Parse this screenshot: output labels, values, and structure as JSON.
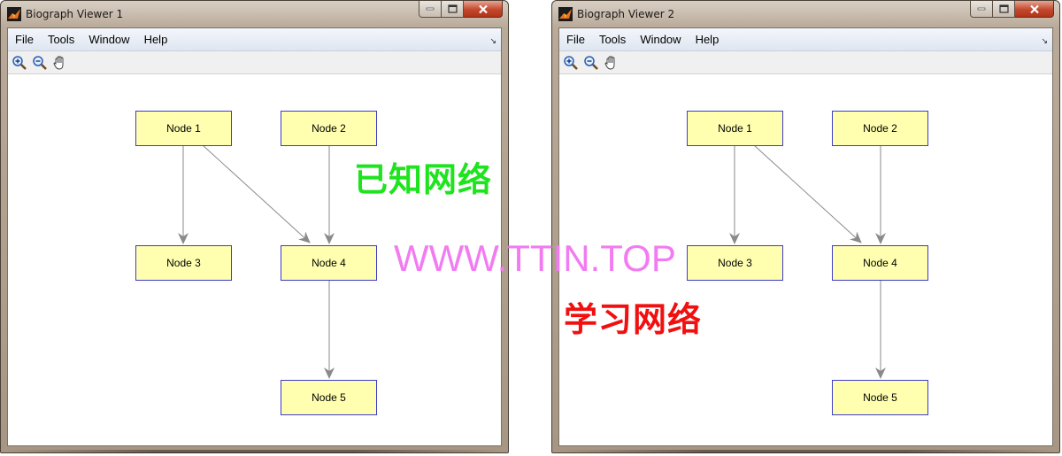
{
  "colors": {
    "node_fill": "#ffffaf",
    "node_border": "#3c3cc8",
    "edge": "#888888",
    "menubar": "#e6ebf3",
    "overlay_known": "#1fe31f",
    "overlay_url": "#f27bf2",
    "overlay_learn": "#f01010"
  },
  "icons": {
    "app": "matlab-logo-icon",
    "minimize": "minimize-icon",
    "maximize": "maximize-icon",
    "close": "close-icon",
    "zoom_in": "zoom-in-icon",
    "zoom_out": "zoom-out-icon",
    "pan": "pan-hand-icon",
    "dock": "dock-arrow-icon"
  },
  "windows": [
    {
      "title": "Biograph Viewer 1",
      "menu": [
        "File",
        "Tools",
        "Window",
        "Help"
      ],
      "nodes": [
        "Node 1",
        "Node 2",
        "Node 3",
        "Node 4",
        "Node 5"
      ],
      "edges": [
        [
          "Node 1",
          "Node 3"
        ],
        [
          "Node 1",
          "Node 4"
        ],
        [
          "Node 2",
          "Node 4"
        ],
        [
          "Node 4",
          "Node 5"
        ]
      ]
    },
    {
      "title": "Biograph Viewer 2",
      "menu": [
        "File",
        "Tools",
        "Window",
        "Help"
      ],
      "nodes": [
        "Node 1",
        "Node 2",
        "Node 3",
        "Node 4",
        "Node 5"
      ],
      "edges": [
        [
          "Node 1",
          "Node 3"
        ],
        [
          "Node 1",
          "Node 4"
        ],
        [
          "Node 2",
          "Node 4"
        ],
        [
          "Node 4",
          "Node 5"
        ]
      ]
    }
  ],
  "overlays": {
    "known_network": "已知网络",
    "url": "WWW.TTIN.TOP",
    "learned_network": "学习网络"
  }
}
